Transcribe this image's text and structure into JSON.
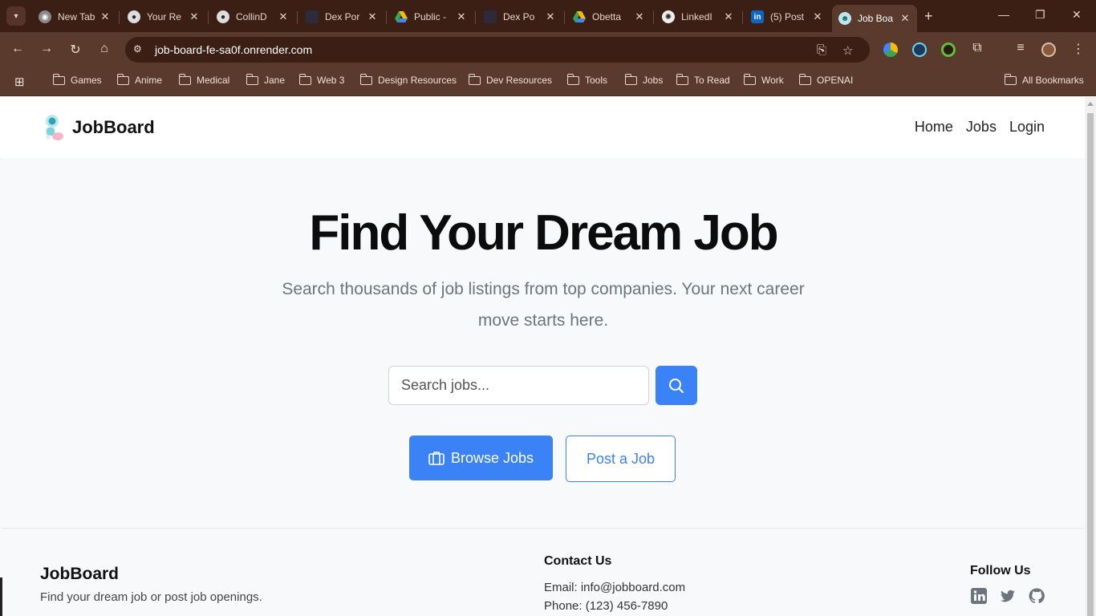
{
  "browser": {
    "tabs": [
      {
        "title": "New Tab"
      },
      {
        "title": "Your Re"
      },
      {
        "title": "CollinD"
      },
      {
        "title": "Dex Por"
      },
      {
        "title": "Public -"
      },
      {
        "title": "Dex Po"
      },
      {
        "title": "Obetta"
      },
      {
        "title": "LinkedI"
      },
      {
        "title": "(5) Post"
      },
      {
        "title": "Job Boa"
      }
    ],
    "url": "job-board-fe-sa0f.onrender.com",
    "bookmarks": [
      "Games",
      "Anime",
      "Medical",
      "Jane",
      "Web 3",
      "Design Resources",
      "Dev Resources",
      "Tools",
      "Jobs",
      "To Read",
      "Work",
      "OPENAI"
    ],
    "all_bookmarks": "All Bookmarks"
  },
  "navbar": {
    "brand": "JobBoard",
    "links": [
      "Home",
      "Jobs",
      "Login"
    ]
  },
  "hero": {
    "title": "Find Your Dream Job",
    "subtitle": "Search thousands of job listings from top companies. Your next career move starts here.",
    "search_placeholder": "Search jobs...",
    "browse_label": "Browse Jobs",
    "post_label": "Post a Job"
  },
  "footer": {
    "brand": "JobBoard",
    "tagline": "Find your dream job or post job openings.",
    "contact_heading": "Contact Us",
    "email": "Email: info@jobboard.com",
    "phone": "Phone: (123) 456-7890",
    "follow_heading": "Follow Us",
    "social": [
      "linkedin-icon",
      "twitter-icon",
      "github-icon"
    ]
  },
  "colors": {
    "primary": "#3b82f6",
    "chrome_dark": "#3b1f14",
    "chrome": "#5a3a2c"
  }
}
